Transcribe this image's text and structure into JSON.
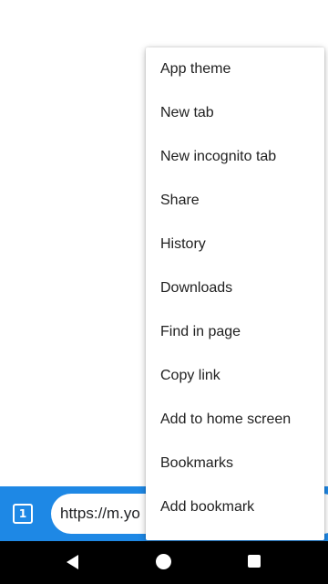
{
  "tab_switcher": {
    "count": "1"
  },
  "url_bar": {
    "value": "https://m.yo"
  },
  "menu": {
    "items": [
      {
        "label": "App theme"
      },
      {
        "label": "New tab"
      },
      {
        "label": "New incognito tab"
      },
      {
        "label": "Share"
      },
      {
        "label": "History"
      },
      {
        "label": "Downloads"
      },
      {
        "label": "Find in page"
      },
      {
        "label": "Copy link"
      },
      {
        "label": "Add to home screen"
      },
      {
        "label": "Bookmarks"
      },
      {
        "label": "Add bookmark"
      }
    ]
  },
  "colors": {
    "toolbar": "#1e88e5",
    "nav_bar": "#000000",
    "menu_bg": "#ffffff"
  },
  "icons": {
    "nav_back": "triangle-back-icon",
    "nav_home": "circle-home-icon",
    "nav_recents": "square-recents-icon"
  }
}
